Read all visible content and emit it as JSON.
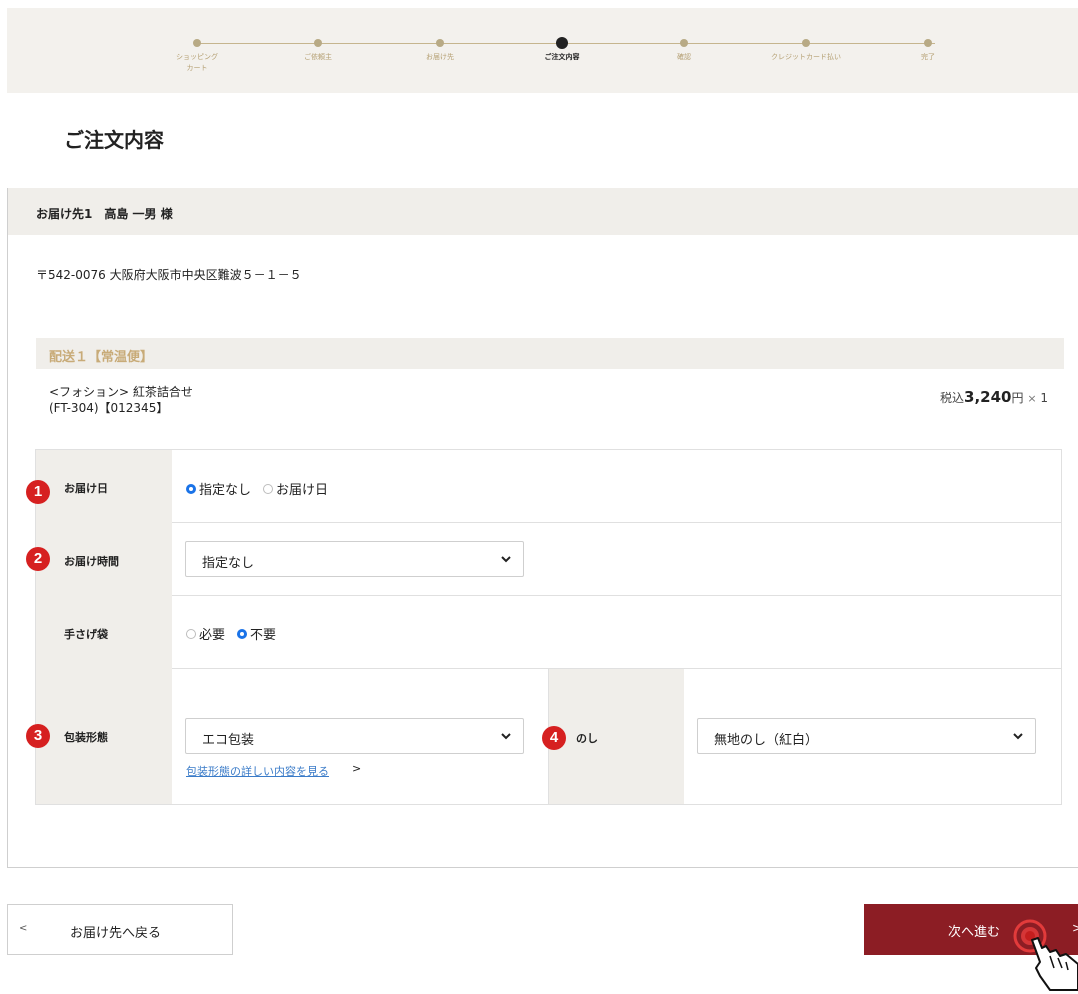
{
  "stepper": {
    "steps": [
      {
        "label_line1": "ショッピング",
        "label_line2": "カート",
        "active": false
      },
      {
        "label_line1": "ご依頼主",
        "label_line2": "",
        "active": false
      },
      {
        "label_line1": "お届け先",
        "label_line2": "",
        "active": false
      },
      {
        "label_line1": "ご注文内容",
        "label_line2": "",
        "active": true
      },
      {
        "label_line1": "確認",
        "label_line2": "",
        "active": false
      },
      {
        "label_line1": "クレジットカード払い",
        "label_line2": "",
        "active": false
      },
      {
        "label_line1": "完了",
        "label_line2": "",
        "active": false
      }
    ]
  },
  "page": {
    "title": "ご注文内容"
  },
  "destination": {
    "header": "お届け先1　高島 一男 様",
    "address": "〒542-0076 大阪府大阪市中央区難波５－１－５",
    "shipment_header": "配送１【常温便】",
    "product": {
      "name": "<フォション> 紅茶詰合せ",
      "code": "(FT-304)【012345】",
      "price_prefix": "税込",
      "price": "3,240",
      "price_unit": "円",
      "qty_sep": "×",
      "qty": "1"
    }
  },
  "form": {
    "delivery_date": {
      "badge": "1",
      "label": "お届け日",
      "options": [
        "指定なし",
        "お届け日"
      ],
      "selected": 0
    },
    "delivery_time": {
      "badge": "2",
      "label": "お届け時間",
      "value": "指定なし"
    },
    "bag": {
      "label": "手さげ袋",
      "options": [
        "必要",
        "不要"
      ],
      "selected": 1
    },
    "wrapping": {
      "badge": "3",
      "label": "包装形態",
      "value": "エコ包装",
      "link": "包装形態の詳しい内容を見る",
      "link_arrow": ">"
    },
    "noshi": {
      "badge": "4",
      "label": "のし",
      "value": "無地のし（紅白）"
    }
  },
  "buttons": {
    "back_arrow": "<",
    "back": "お届け先へ戻る",
    "next": "次へ進む",
    "next_arrow": ">"
  },
  "colors": {
    "brand": "#8c1d24",
    "badge": "#d62020",
    "radio_on": "#1a73e8",
    "link": "#3a7bc8",
    "gold": "#c8ab78"
  }
}
